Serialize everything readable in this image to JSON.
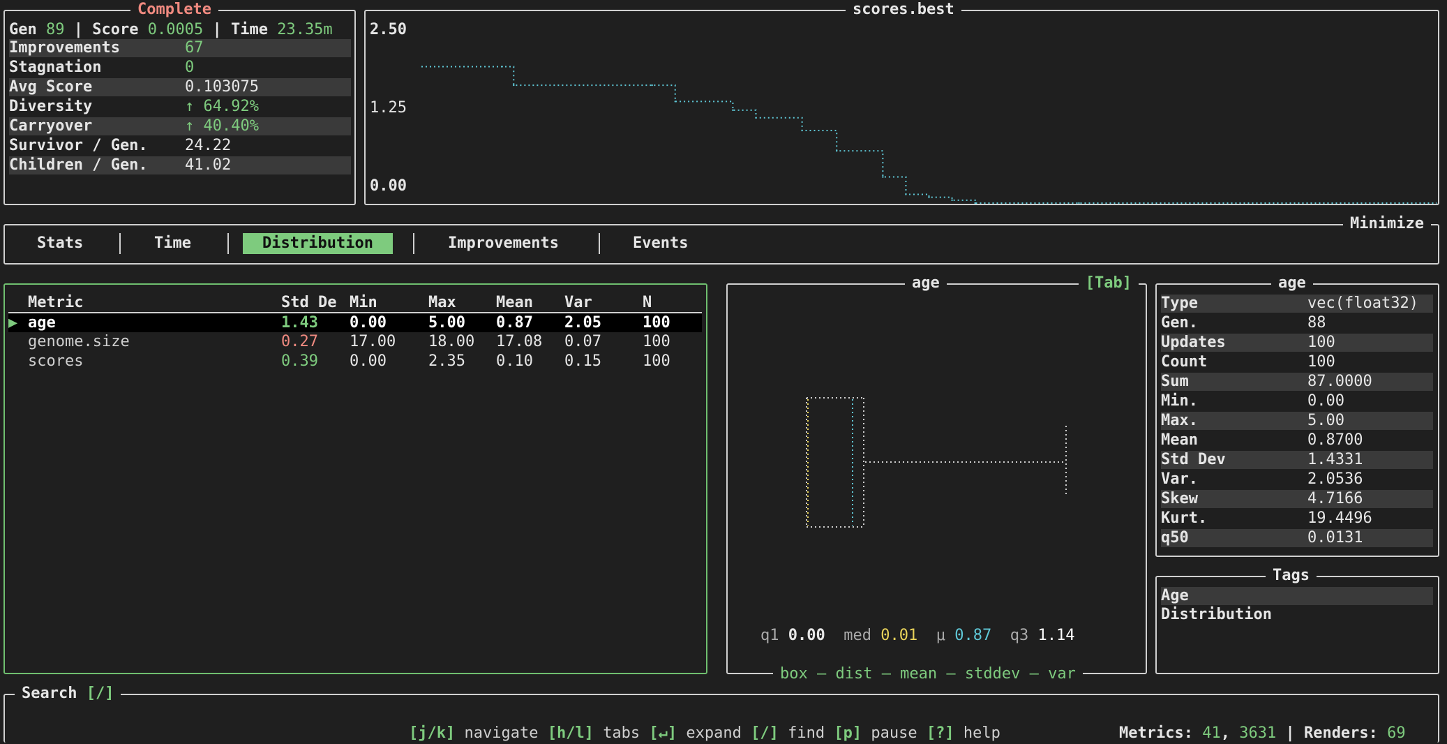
{
  "status": {
    "title": "Complete",
    "gen_label": "Gen",
    "gen": "89",
    "score_label": "Score",
    "score": "0.0005",
    "time_label": "Time",
    "time": "23.35m",
    "rows": [
      {
        "label": "Improvements",
        "value": "67"
      },
      {
        "label": "Stagnation",
        "value": "0"
      },
      {
        "label": "Avg Score",
        "value": "0.103075"
      },
      {
        "label": "Diversity",
        "value": "↑ 64.92%"
      },
      {
        "label": "Carryover",
        "value": "↑ 40.40%"
      },
      {
        "label": "Survivor / Gen.",
        "value": "24.22"
      },
      {
        "label": "Children / Gen.",
        "value": "41.02"
      }
    ]
  },
  "chart_data": {
    "type": "line",
    "title": "scores.best",
    "ylim": [
      0,
      2.5
    ],
    "yticks": [
      "2.50",
      "1.25",
      "0.00"
    ],
    "x": [
      0,
      7,
      8,
      20,
      22,
      27,
      29,
      33,
      36,
      40,
      42,
      44,
      46,
      48,
      57,
      88
    ],
    "values": [
      2.35,
      2.35,
      2.03,
      2.03,
      1.75,
      1.6,
      1.47,
      1.25,
      0.9,
      0.45,
      0.15,
      0.1,
      0.05,
      0.0,
      0.0,
      0.0
    ],
    "grid": false
  },
  "tabs": {
    "minimize": "Minimize",
    "items": [
      "Stats",
      "Time",
      "Distribution",
      "Improvements",
      "Events"
    ],
    "active": "Distribution"
  },
  "metrics": {
    "headers": [
      "Metric",
      "Std De",
      "Min",
      "Max",
      "Mean",
      "Var",
      "N"
    ],
    "selected_marker": "▶",
    "rows": [
      {
        "name": "age",
        "std": "1.43",
        "min": "0.00",
        "max": "5.00",
        "mean": "0.87",
        "var": "2.05",
        "n": "100"
      },
      {
        "name": "genome.size",
        "std": "0.27",
        "min": "17.00",
        "max": "18.00",
        "mean": "17.08",
        "var": "0.07",
        "n": "100"
      },
      {
        "name": "scores",
        "std": "0.39",
        "min": "0.00",
        "max": "2.35",
        "mean": "0.10",
        "var": "0.15",
        "n": "100"
      }
    ]
  },
  "boxplot": {
    "title": "age",
    "hint": "[Tab]",
    "q1_label": "q1",
    "q1": "0.00",
    "med_label": "med",
    "med": "0.01",
    "mu_label": "μ",
    "mu": "0.87",
    "q3_label": "q3",
    "q3": "1.14",
    "modes": "box – dist – mean – stddev – var"
  },
  "details": {
    "title": "age",
    "rows": [
      {
        "label": "Type",
        "value": "vec(float32)"
      },
      {
        "label": "Gen.",
        "value": "88"
      },
      {
        "label": "Updates",
        "value": "100"
      },
      {
        "label": "Count",
        "value": "100"
      },
      {
        "label": "Sum",
        "value": "87.0000"
      },
      {
        "label": "Min.",
        "value": "0.00"
      },
      {
        "label": "Max.",
        "value": "5.00"
      },
      {
        "label": "Mean",
        "value": "0.8700"
      },
      {
        "label": "Std Dev",
        "value": "1.4331"
      },
      {
        "label": "Var.",
        "value": "2.0536"
      },
      {
        "label": "Skew",
        "value": "4.7166"
      },
      {
        "label": "Kurt.",
        "value": "19.4496"
      },
      {
        "label": "q50",
        "value": "0.0131"
      }
    ]
  },
  "tags": {
    "title": "Tags",
    "items": [
      "Age",
      "Distribution"
    ]
  },
  "search": {
    "label": "Search",
    "key": "[/]"
  },
  "footer": {
    "keys": [
      {
        "key": "[j/k]",
        "action": "navigate"
      },
      {
        "key": "[h/l]",
        "action": "tabs"
      },
      {
        "key": "[↵]",
        "action": "expand"
      },
      {
        "key": "[/]",
        "action": "find"
      },
      {
        "key": "[p]",
        "action": "pause"
      },
      {
        "key": "[?]",
        "action": "help"
      }
    ],
    "metrics_label": "Metrics:",
    "metrics_a": "41",
    "metrics_b": "3631",
    "renders_label": "Renders:",
    "renders": "69"
  },
  "colors": {
    "accent": "#7ecb7e",
    "line": "#5fc7d6",
    "warn": "#f08a80",
    "median": "#e8d25a"
  }
}
